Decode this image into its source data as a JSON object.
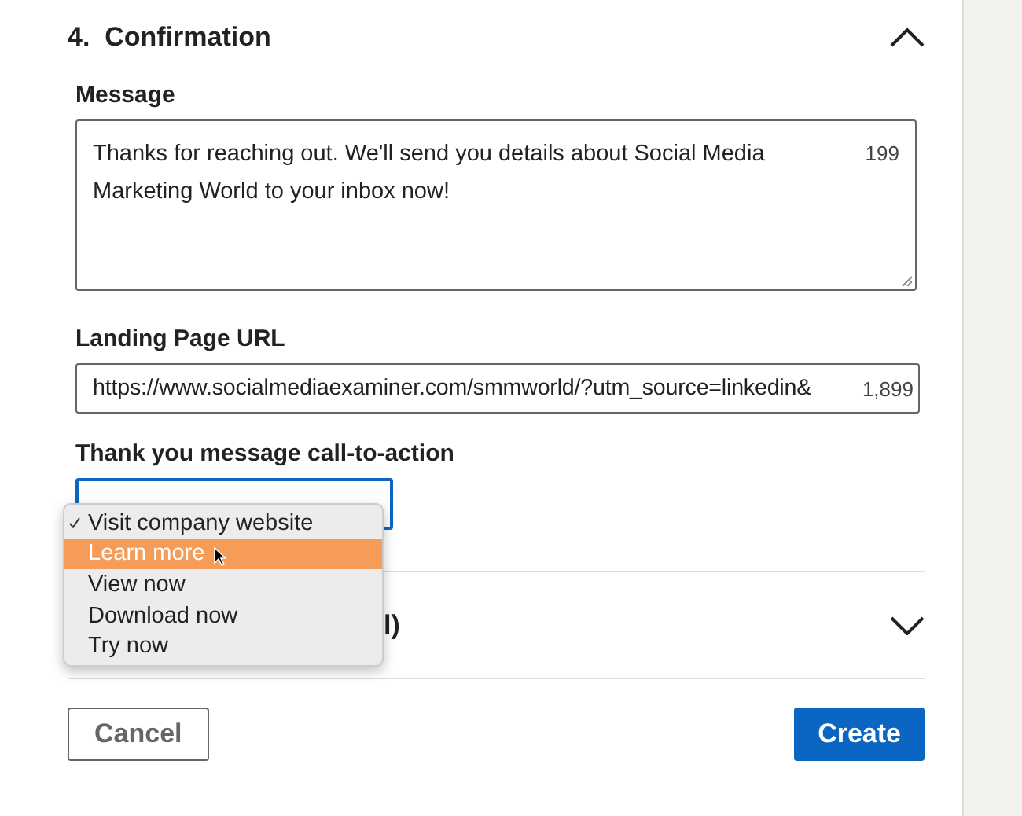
{
  "section": {
    "number": "4.",
    "title": "Confirmation",
    "expanded": true
  },
  "message": {
    "label": "Message",
    "value": "Thanks for reaching out. We'll send you details about Social Media Marketing World to your inbox now!",
    "counter": "199"
  },
  "landing_url": {
    "label": "Landing Page URL",
    "value": "https://www.socialmediaexaminer.com/smmworld/?utm_source=linkedin&",
    "counter": "1,899"
  },
  "cta": {
    "label": "Thank you message call-to-action",
    "options": [
      {
        "label": "Visit company website",
        "selected": true,
        "highlighted": false
      },
      {
        "label": "Learn more",
        "selected": false,
        "highlighted": true
      },
      {
        "label": "View now",
        "selected": false,
        "highlighted": false
      },
      {
        "label": "Download now",
        "selected": false,
        "highlighted": false
      },
      {
        "label": "Try now",
        "selected": false,
        "highlighted": false
      }
    ]
  },
  "next_section": {
    "title": "l)",
    "expanded": false
  },
  "buttons": [
    {
      "label": "Cancel",
      "kind": "secondary"
    },
    {
      "label": "Create",
      "kind": "primary"
    }
  ]
}
